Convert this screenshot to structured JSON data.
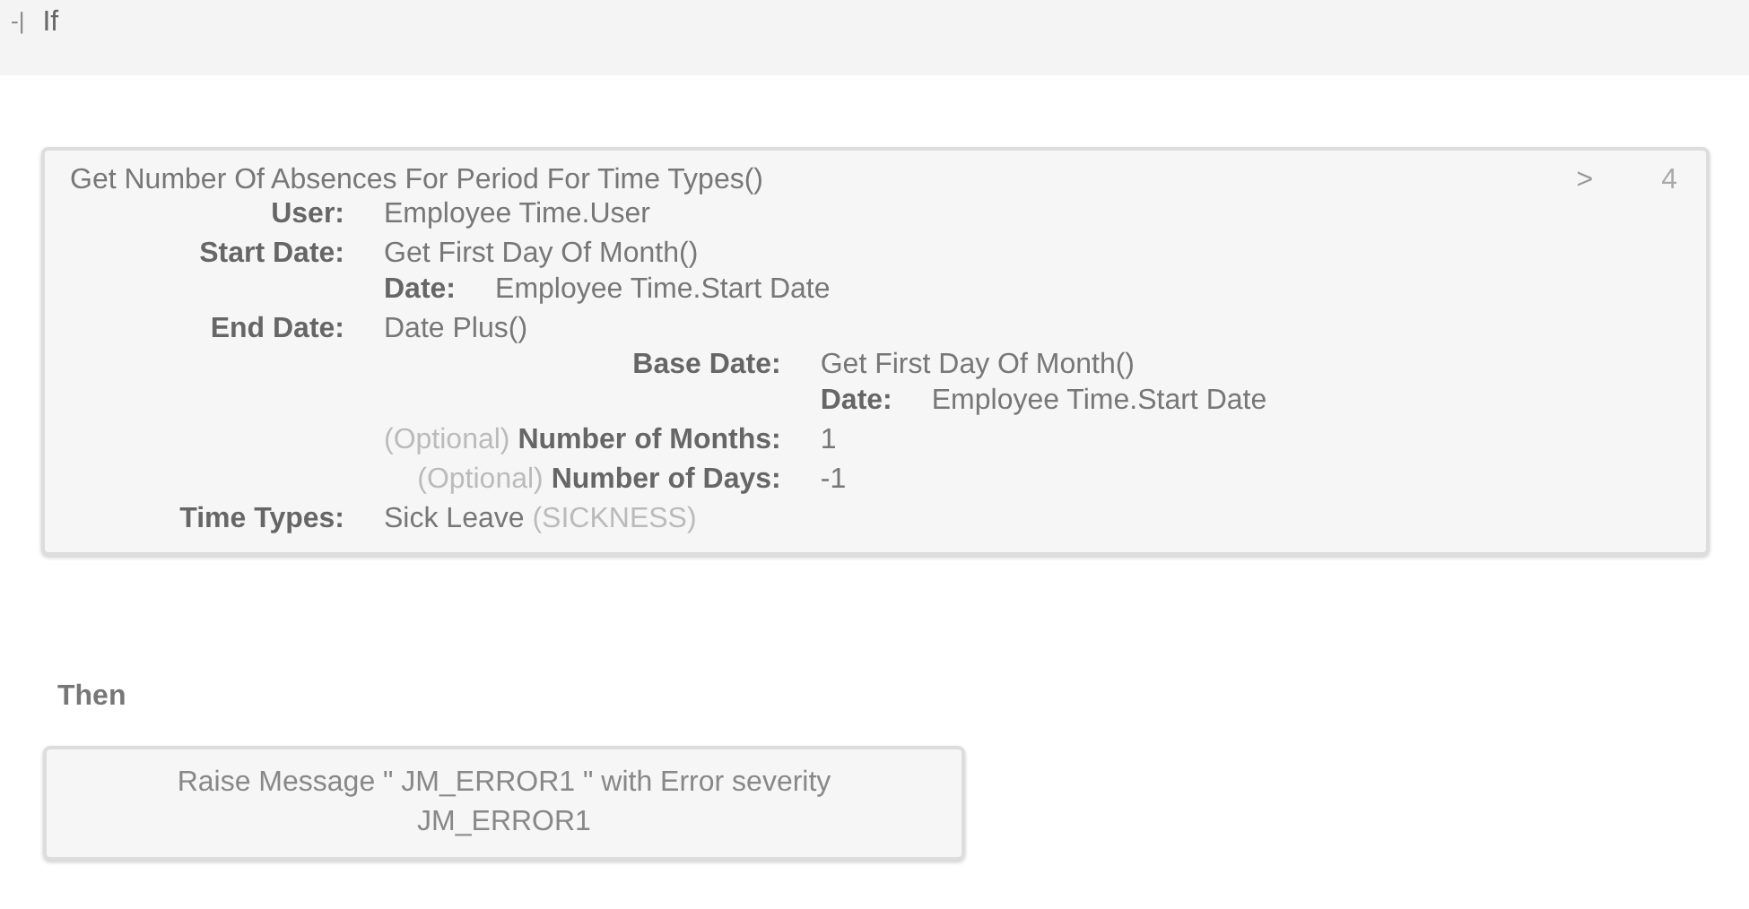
{
  "condition_header": {
    "toggle": "-|",
    "label": "If"
  },
  "expression": {
    "title": "Get Number Of Absences For Period For Time Types()",
    "nav": ">",
    "count": "4",
    "params": [
      {
        "label": "User:",
        "value": "Employee Time.User"
      },
      {
        "label": "Start Date:",
        "value": "Get First Day Of Month()",
        "children": [
          {
            "label": "Date:",
            "value": "Employee Time.Start Date"
          }
        ]
      },
      {
        "label": "End Date:",
        "value": "Date Plus()",
        "children": [
          {
            "label": "Base Date:",
            "value": "Get First Day Of Month()",
            "children": [
              {
                "label": "Date:",
                "value": "Employee Time.Start Date"
              }
            ]
          },
          {
            "optional": "(Optional)",
            "label": "Number of Months:",
            "value": "1"
          },
          {
            "optional": "(Optional)",
            "label": "Number of Days:",
            "value": "-1"
          }
        ]
      },
      {
        "label": "Time Types:",
        "value": "Sick Leave",
        "code": "(SICKNESS)"
      }
    ]
  },
  "then_label": "Then",
  "action": {
    "lines": [
      "Raise Message  \" JM_ERROR1 \" with Error severity",
      "JM_ERROR1"
    ]
  }
}
